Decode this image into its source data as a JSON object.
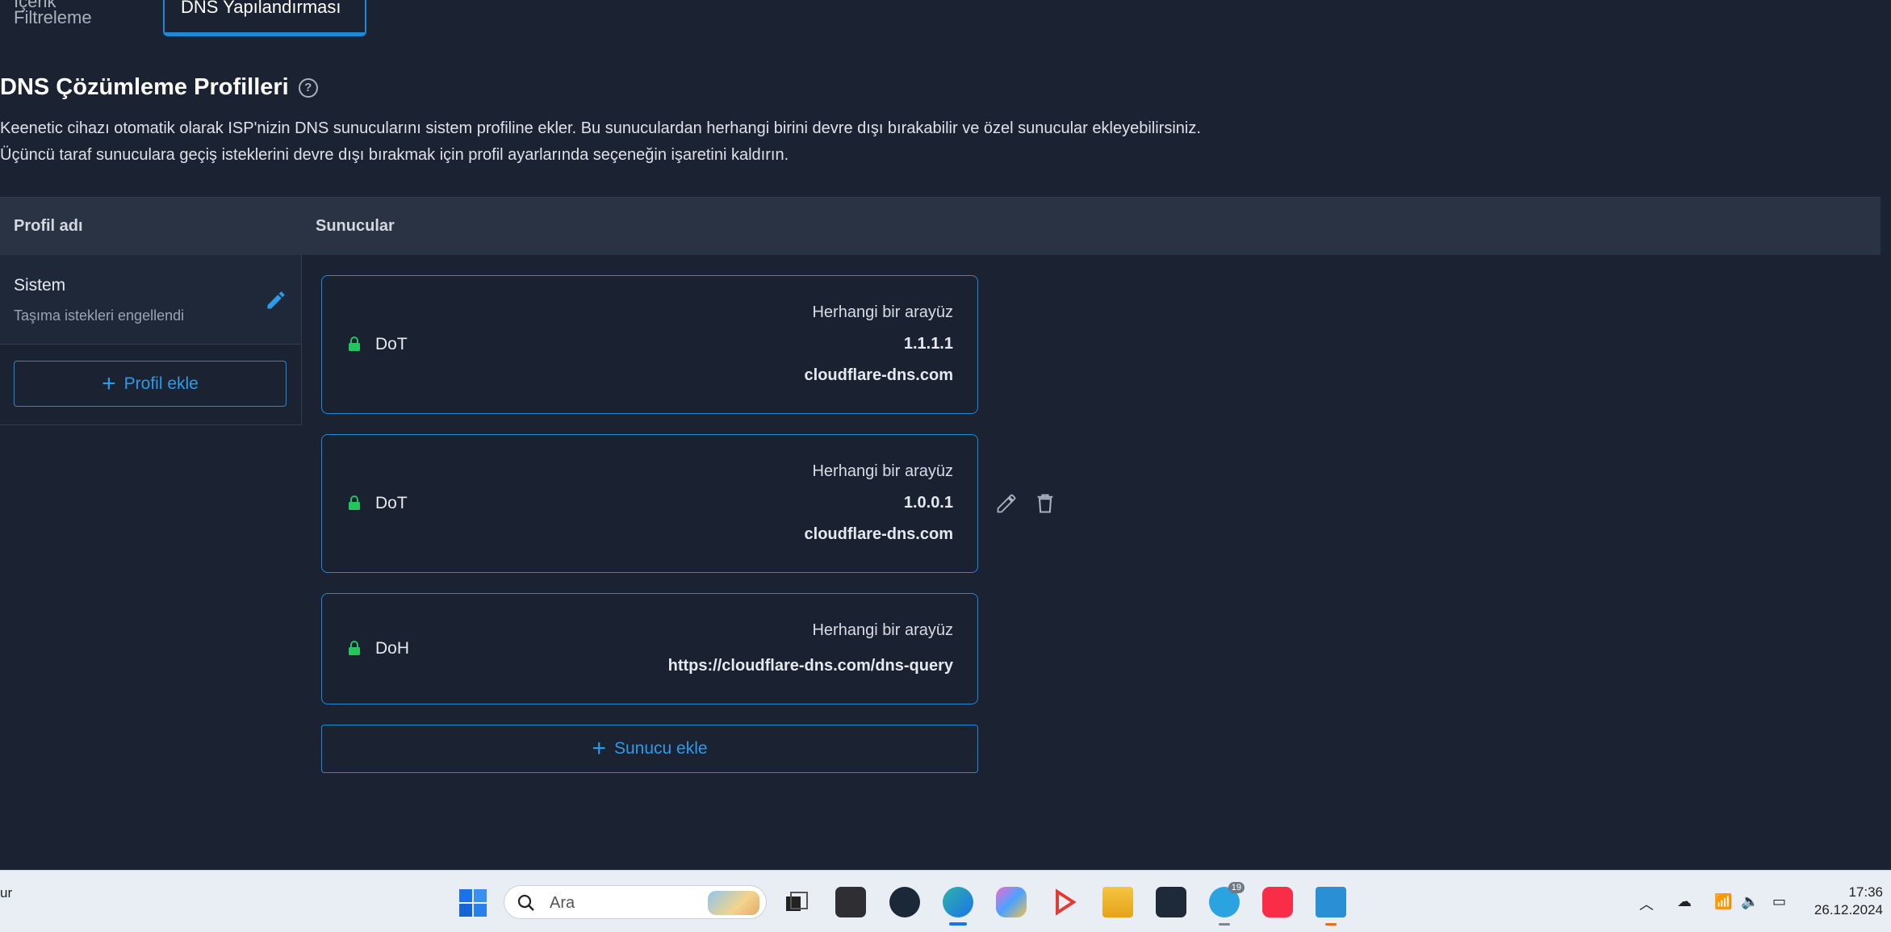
{
  "tabs": [
    "İçerik Filtreleme",
    "DNS Yapılandırması"
  ],
  "page": {
    "title": "DNS Çözümleme Profilleri",
    "description_1": "Keenetic cihazı otomatik olarak ISP'nizin DNS sunucularını sistem profiline ekler. Bu sunuculardan herhangi birini devre dışı bırakabilir ve özel sunucular ekleyebilirsiniz.",
    "description_2": "Üçüncü taraf sunuculara geçiş isteklerini devre dışı bırakmak için profil ayarlarında seçeneğin işaretini kaldırın."
  },
  "table": {
    "col_profile": "Profil adı",
    "col_servers": "Sunucular"
  },
  "profile": {
    "name": "Sistem",
    "subtitle": "Taşıma istekleri engellendi",
    "add_label": "Profil ekle"
  },
  "servers": [
    {
      "protocol": "DoT",
      "interface": "Herhangi bir arayüz",
      "ip": "1.1.1.1",
      "host": "cloudflare-dns.com"
    },
    {
      "protocol": "DoT",
      "interface": "Herhangi bir arayüz",
      "ip": "1.0.0.1",
      "host": "cloudflare-dns.com"
    },
    {
      "protocol": "DoH",
      "interface": "Herhangi bir arayüz",
      "host": "https://cloudflare-dns.com/dns-query"
    }
  ],
  "add_server_label": "Sunucu ekle",
  "colors": {
    "accent": "#1f8ad6",
    "lock": "#22c55e",
    "background": "#1b2333"
  },
  "taskbar": {
    "left_text": "ur",
    "search_placeholder": "Ara",
    "telegram_badge": "19",
    "time": "17:36",
    "date": "26.12.2024"
  }
}
